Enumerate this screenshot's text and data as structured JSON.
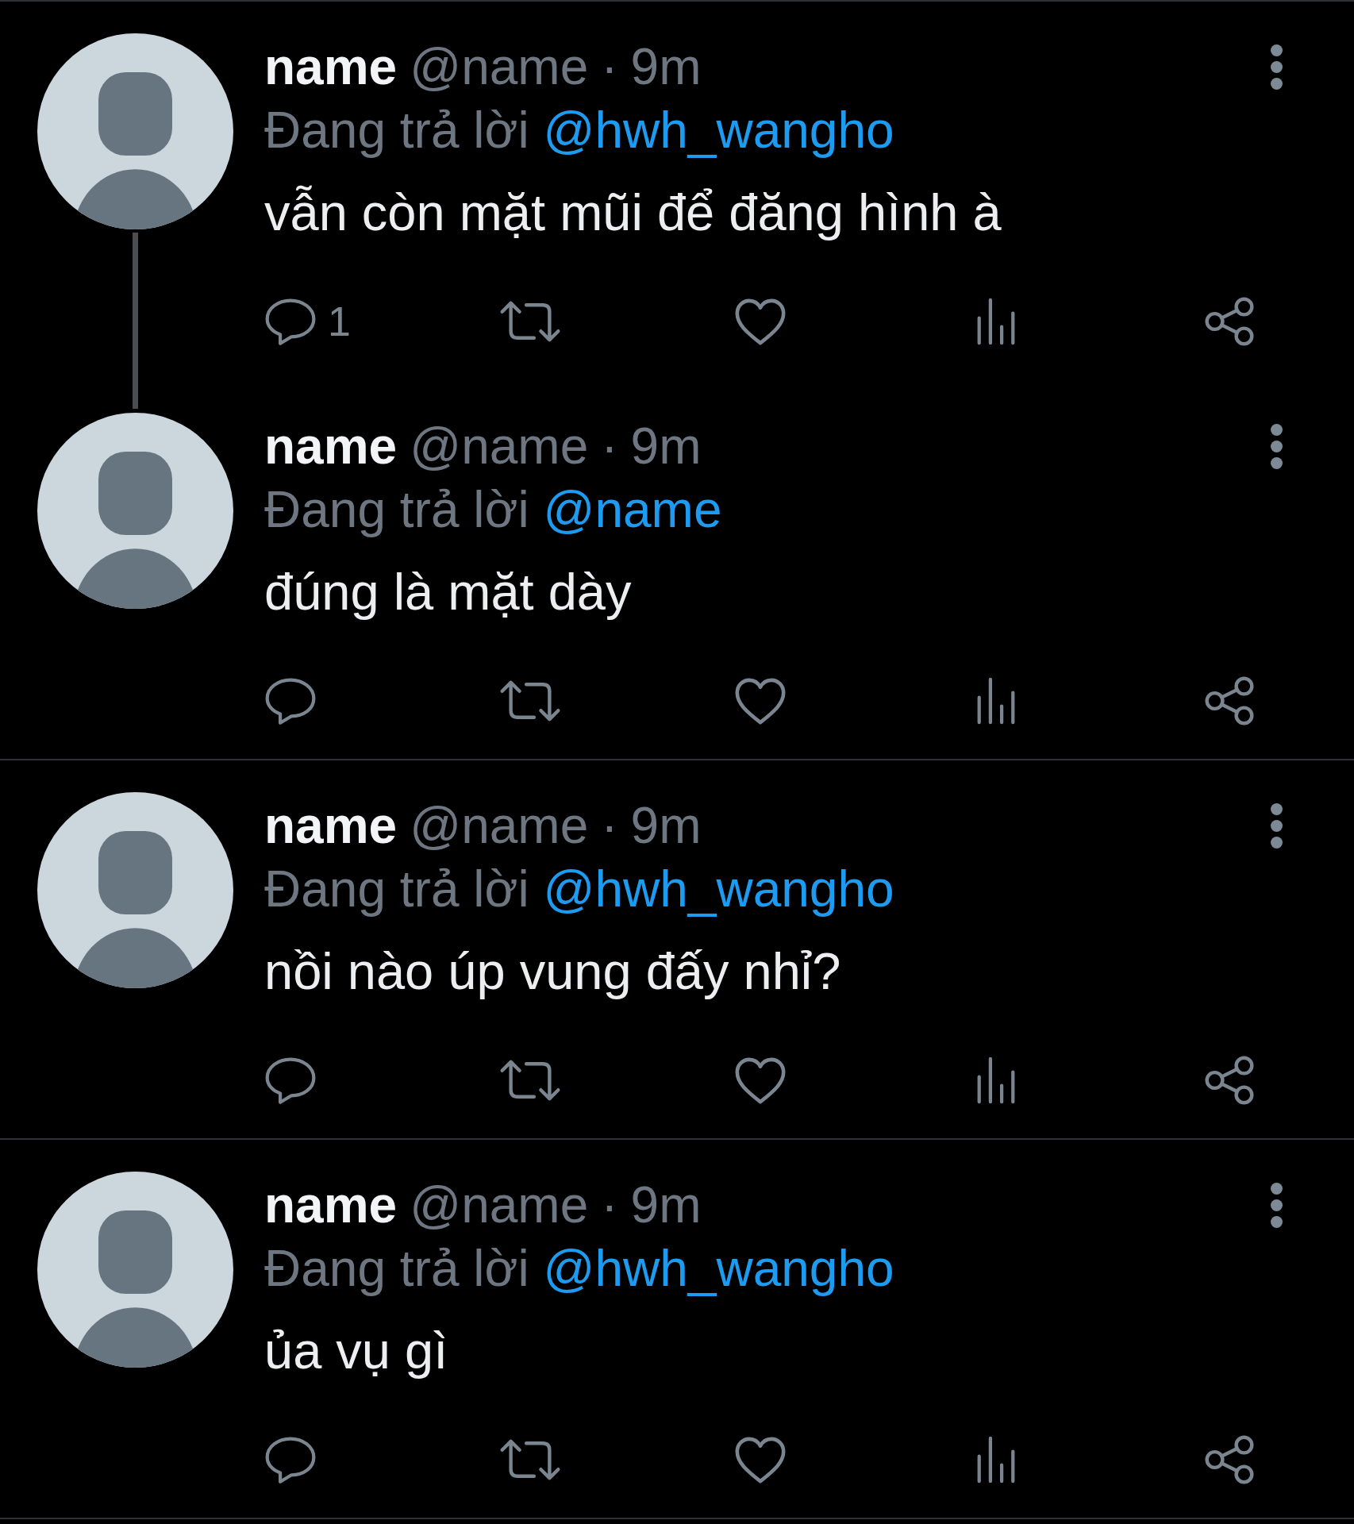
{
  "tweets": [
    {
      "name": "name",
      "handle": "@name",
      "separator": "·",
      "time": "9m",
      "reply_label": "Đang trả lời",
      "reply_to": "@hwh_wangho",
      "text": "vẫn còn mặt mũi để đăng hình à",
      "thread_continues": true,
      "actions": [
        {
          "kind": "reply",
          "count": "1"
        },
        {
          "kind": "retweet"
        },
        {
          "kind": "like"
        },
        {
          "kind": "views"
        },
        {
          "kind": "share"
        }
      ]
    },
    {
      "name": "name",
      "handle": "@name",
      "separator": "·",
      "time": "9m",
      "reply_label": "Đang trả lời",
      "reply_to": "@name",
      "text": "đúng là mặt dày",
      "thread_continues": false,
      "actions": [
        {
          "kind": "reply"
        },
        {
          "kind": "retweet"
        },
        {
          "kind": "like"
        },
        {
          "kind": "views"
        },
        {
          "kind": "share"
        }
      ]
    },
    {
      "name": "name",
      "handle": "@name",
      "separator": "·",
      "time": "9m",
      "reply_label": "Đang trả lời",
      "reply_to": "@hwh_wangho",
      "text": "nồi nào úp vung đấy nhỉ?",
      "thread_continues": false,
      "actions": [
        {
          "kind": "reply"
        },
        {
          "kind": "retweet"
        },
        {
          "kind": "like"
        },
        {
          "kind": "views"
        },
        {
          "kind": "share"
        }
      ]
    },
    {
      "name": "name",
      "handle": "@name",
      "separator": "·",
      "time": "9m",
      "reply_label": "Đang trả lời",
      "reply_to": "@hwh_wangho",
      "text": "ủa vụ gì",
      "thread_continues": false,
      "actions": [
        {
          "kind": "reply"
        },
        {
          "kind": "retweet"
        },
        {
          "kind": "like"
        },
        {
          "kind": "views"
        },
        {
          "kind": "share"
        }
      ]
    }
  ]
}
